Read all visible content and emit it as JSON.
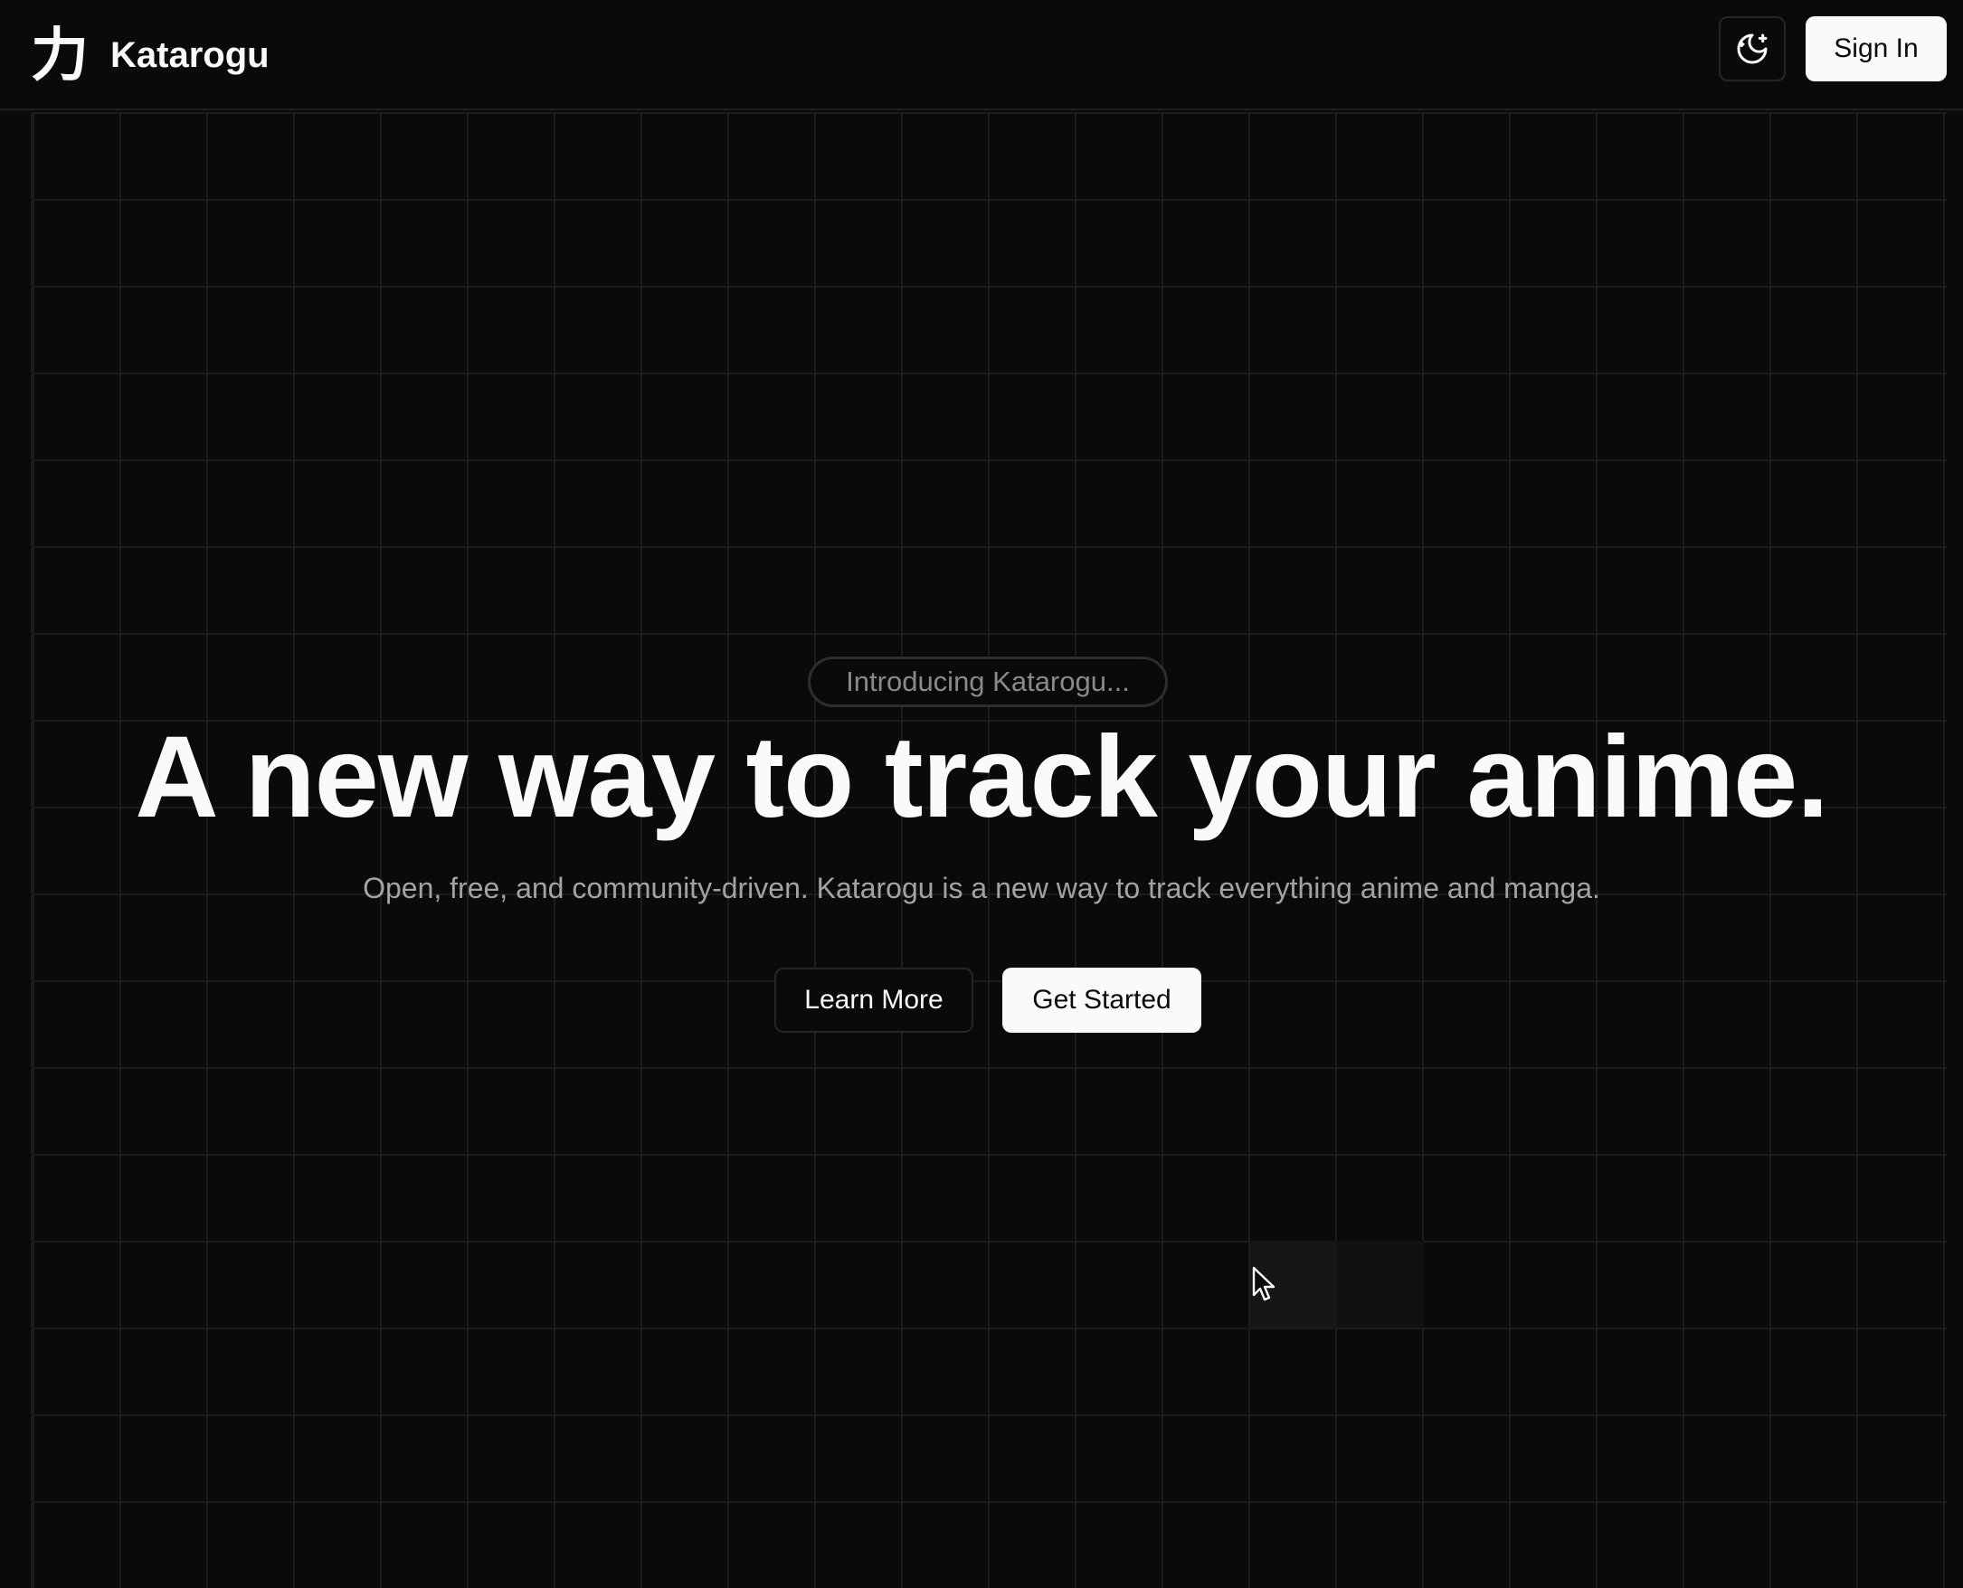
{
  "header": {
    "logo_glyph": "力",
    "brand_name": "Katarogu",
    "theme_toggle_icon": "moon-stars-icon",
    "sign_in_label": "Sign In"
  },
  "hero": {
    "badge": "Introducing Katarogu...",
    "headline": "A new way to track your anime.",
    "subtitle": "Open, free, and community-driven. Katarogu is a new way to track everything anime and manga.",
    "learn_more_label": "Learn More",
    "get_started_label": "Get Started"
  },
  "colors": {
    "background": "#0a0a0a",
    "foreground": "#fafafa",
    "muted_text": "#a3a3a3",
    "grid_line": "#1c1c1c",
    "border": "#262626"
  }
}
